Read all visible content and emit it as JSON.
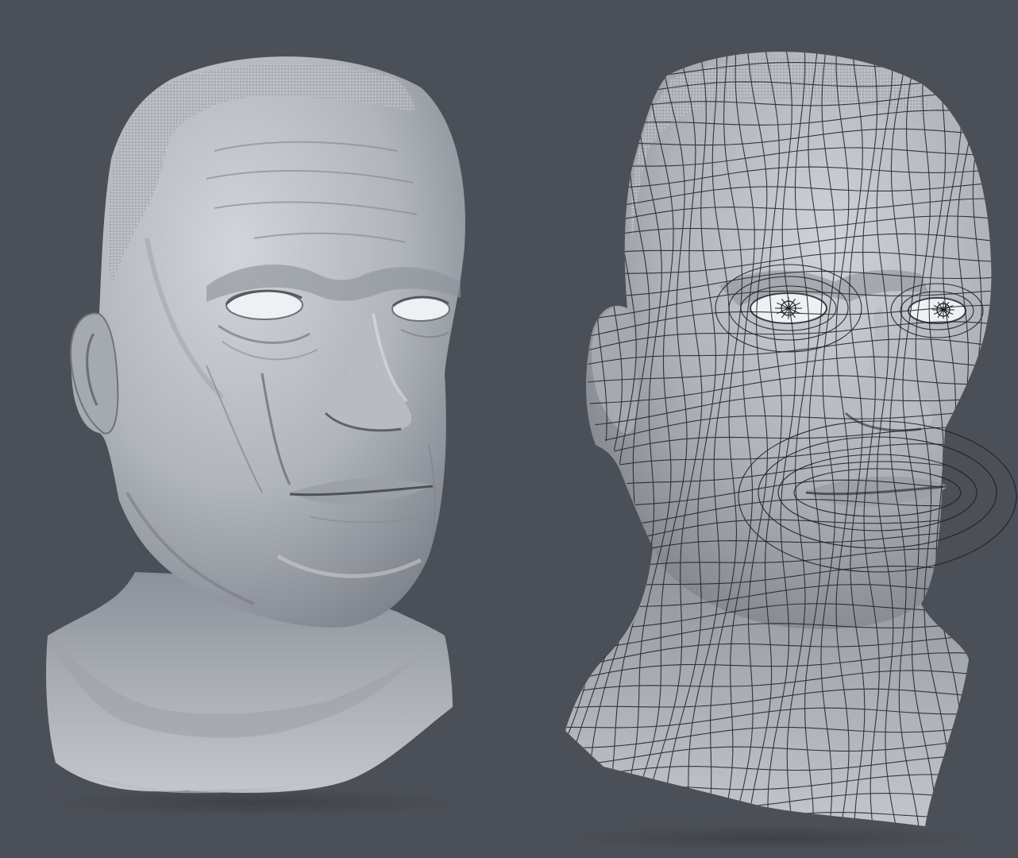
{
  "scene": {
    "background": "#4b4f57",
    "skin_light": "#c9ccd1",
    "skin_mid": "#a6aab1",
    "skin_dark": "#7d828b",
    "wire_color": "#1c1e22",
    "eye_white": "#f2f3f5"
  }
}
